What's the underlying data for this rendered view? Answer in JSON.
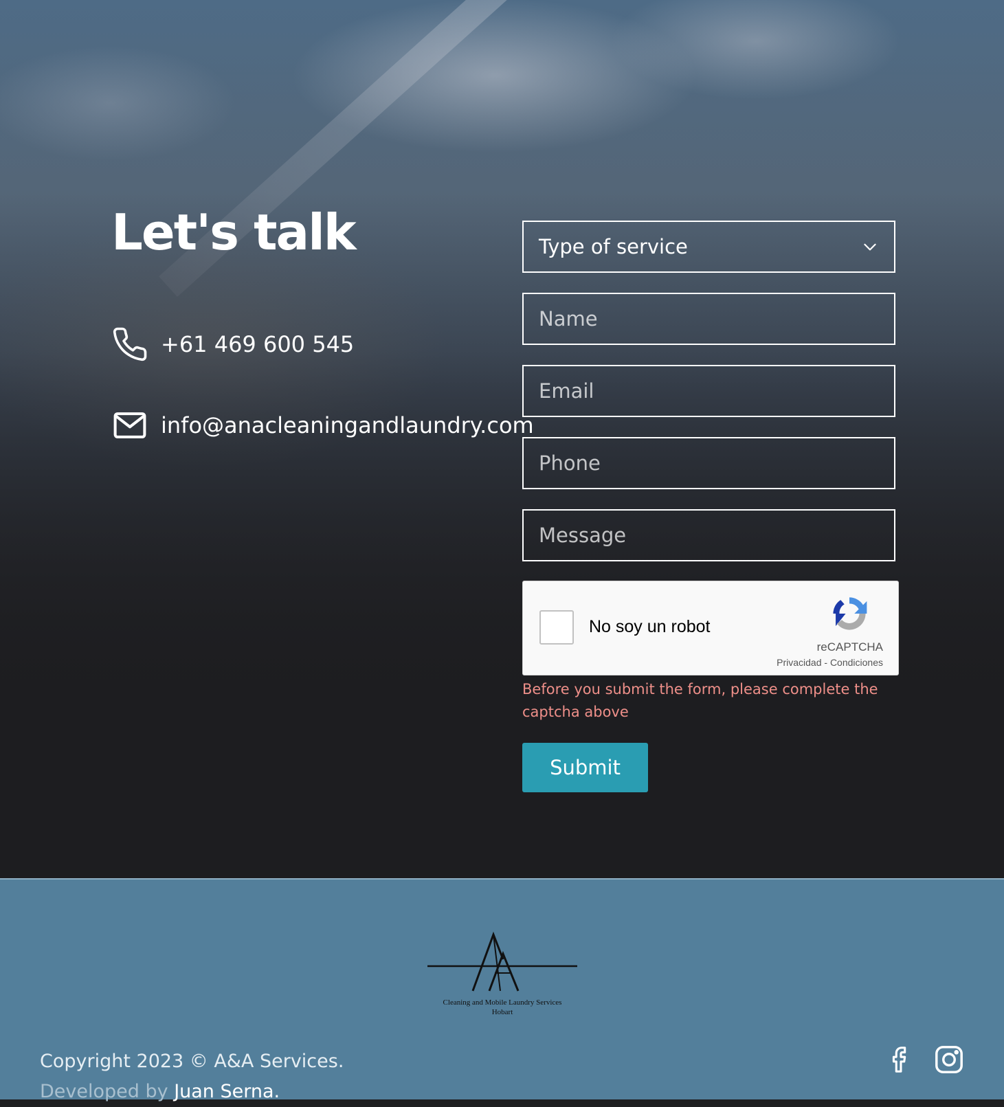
{
  "contact": {
    "title": "Let's talk",
    "phone": "+61 469 600 545",
    "email": "info@anacleaningandlaundry.com"
  },
  "form": {
    "service_select": {
      "selected": "Type of service",
      "options": [
        "Type of service"
      ]
    },
    "name_placeholder": "Name",
    "email_placeholder": "Email",
    "phone_placeholder": "Phone",
    "message_placeholder": "Message",
    "captcha": {
      "label": "No soy un robot",
      "brand": "reCAPTCHA",
      "privacy": "Privacidad",
      "separator": " - ",
      "terms": "Condiciones"
    },
    "error": "Before you submit the form, please complete the captcha above",
    "submit_label": "Submit"
  },
  "footer": {
    "logo_tagline": "Cleaning and Mobile Laundry Services",
    "logo_city": "Hobart",
    "copyright": "Copyright 2023 © A&A Services.",
    "developed_prefix": "Developed by ",
    "developer": "Juan Serna.",
    "social": [
      "facebook-icon",
      "instagram-icon"
    ]
  },
  "colors": {
    "accent": "#2a9db2",
    "error": "#ee8f89",
    "footer_bg": "#537f9b",
    "page_bg": "#1f1f21"
  }
}
